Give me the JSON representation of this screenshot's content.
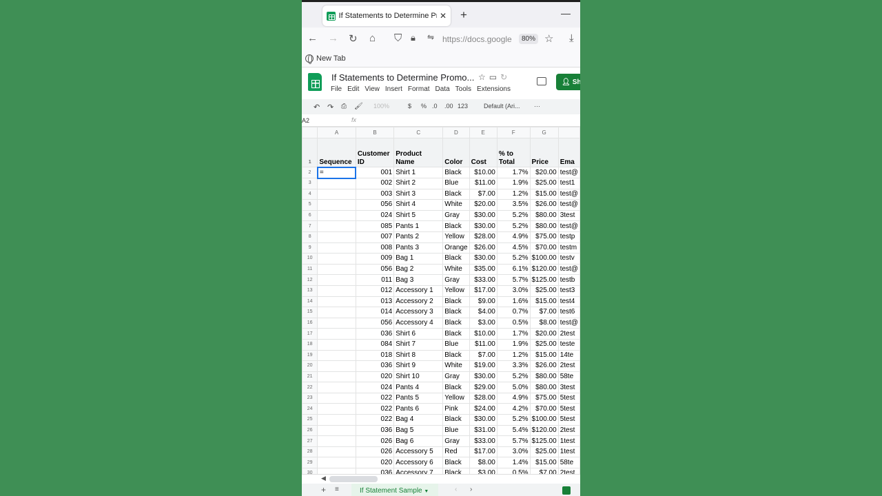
{
  "browser": {
    "tab_title": "If Statements to Determine Promo",
    "url": "https://docs.google",
    "zoom": "80%",
    "bookmark": "New Tab"
  },
  "doc": {
    "title": "If Statements to Determine Promo...",
    "menu": [
      "File",
      "Edit",
      "View",
      "Insert",
      "Format",
      "Data",
      "Tools",
      "Extensions"
    ],
    "share_label": "Sha"
  },
  "toolbar": {
    "zoom": "100%",
    "currency": "$",
    "percent": "%",
    "dec_less": ".0",
    "dec_more": ".00",
    "format_123": "123",
    "font": "Default (Ari...",
    "more": "···"
  },
  "formula": {
    "cell_ref": "A2",
    "fx": "fx"
  },
  "sheet": {
    "columns": [
      "A",
      "B",
      "C",
      "D",
      "E",
      "F",
      "G",
      ""
    ],
    "headers": [
      "Sequence",
      "Customer ID",
      "Product Name",
      "Color",
      "Cost",
      "% to Total",
      "Price",
      "Ema"
    ],
    "active_cell_value": "=",
    "rows": [
      [
        "",
        "001",
        "Shirt 1",
        "Black",
        "$10.00",
        "1.7%",
        "$20.00",
        "test@"
      ],
      [
        "",
        "002",
        "Shirt 2",
        "Blue",
        "$11.00",
        "1.9%",
        "$25.00",
        "test1"
      ],
      [
        "",
        "003",
        "Shirt 3",
        "Black",
        "$7.00",
        "1.2%",
        "$15.00",
        "test@"
      ],
      [
        "",
        "056",
        "Shirt 4",
        "White",
        "$20.00",
        "3.5%",
        "$26.00",
        "test@"
      ],
      [
        "",
        "024",
        "Shirt 5",
        "Gray",
        "$30.00",
        "5.2%",
        "$80.00",
        "3test"
      ],
      [
        "",
        "085",
        "Pants 1",
        "Black",
        "$30.00",
        "5.2%",
        "$80.00",
        "test@"
      ],
      [
        "",
        "007",
        "Pants 2",
        "Yellow",
        "$28.00",
        "4.9%",
        "$75.00",
        "testp"
      ],
      [
        "",
        "008",
        "Pants 3",
        "Orange",
        "$26.00",
        "4.5%",
        "$70.00",
        "testm"
      ],
      [
        "",
        "009",
        "Bag 1",
        "Black",
        "$30.00",
        "5.2%",
        "$100.00",
        "testv"
      ],
      [
        "",
        "056",
        "Bag 2",
        "White",
        "$35.00",
        "6.1%",
        "$120.00",
        "test@"
      ],
      [
        "",
        "011",
        "Bag 3",
        "Gray",
        "$33.00",
        "5.7%",
        "$125.00",
        "testb"
      ],
      [
        "",
        "012",
        "Accessory 1",
        "Yellow",
        "$17.00",
        "3.0%",
        "$25.00",
        "test3"
      ],
      [
        "",
        "013",
        "Accessory 2",
        "Black",
        "$9.00",
        "1.6%",
        "$15.00",
        "test4"
      ],
      [
        "",
        "014",
        "Accessory 3",
        "Black",
        "$4.00",
        "0.7%",
        "$7.00",
        "test6"
      ],
      [
        "",
        "056",
        "Accessory 4",
        "Black",
        "$3.00",
        "0.5%",
        "$8.00",
        "test@"
      ],
      [
        "",
        "036",
        "Shirt 6",
        "Black",
        "$10.00",
        "1.7%",
        "$20.00",
        "2test"
      ],
      [
        "",
        "084",
        "Shirt 7",
        "Blue",
        "$11.00",
        "1.9%",
        "$25.00",
        "teste"
      ],
      [
        "",
        "018",
        "Shirt 8",
        "Black",
        "$7.00",
        "1.2%",
        "$15.00",
        "14te"
      ],
      [
        "",
        "036",
        "Shirt 9",
        "White",
        "$19.00",
        "3.3%",
        "$26.00",
        "2test"
      ],
      [
        "",
        "020",
        "Shirt 10",
        "Gray",
        "$30.00",
        "5.2%",
        "$80.00",
        "58te"
      ],
      [
        "",
        "024",
        "Pants 4",
        "Black",
        "$29.00",
        "5.0%",
        "$80.00",
        "3test"
      ],
      [
        "",
        "022",
        "Pants 5",
        "Yellow",
        "$28.00",
        "4.9%",
        "$75.00",
        "5test"
      ],
      [
        "",
        "022",
        "Pants 6",
        "Pink",
        "$24.00",
        "4.2%",
        "$70.00",
        "5test"
      ],
      [
        "",
        "022",
        "Bag 4",
        "Black",
        "$30.00",
        "5.2%",
        "$100.00",
        "5test"
      ],
      [
        "",
        "036",
        "Bag 5",
        "Blue",
        "$31.00",
        "5.4%",
        "$120.00",
        "2test"
      ],
      [
        "",
        "026",
        "Bag 6",
        "Gray",
        "$33.00",
        "5.7%",
        "$125.00",
        "1test"
      ],
      [
        "",
        "026",
        "Accessory 5",
        "Red",
        "$17.00",
        "3.0%",
        "$25.00",
        "1test"
      ],
      [
        "",
        "020",
        "Accessory 6",
        "Black",
        "$8.00",
        "1.4%",
        "$15.00",
        "58te"
      ],
      [
        "",
        "036",
        "Accessory 7",
        "Black",
        "$3.00",
        "0.5%",
        "$7.00",
        "2test"
      ]
    ]
  },
  "sheet_tab": "If Statement Sample"
}
